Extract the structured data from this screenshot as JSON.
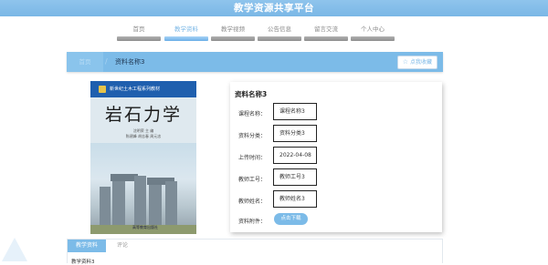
{
  "app": {
    "title": "教学资源共享平台"
  },
  "nav": {
    "items": [
      {
        "label": "首页",
        "active": false
      },
      {
        "label": "教学资料",
        "active": true
      },
      {
        "label": "教学视频",
        "active": false
      },
      {
        "label": "公告信息",
        "active": false
      },
      {
        "label": "留言交流",
        "active": false
      },
      {
        "label": "个人中心",
        "active": false
      }
    ]
  },
  "breadcrumb": {
    "home": "首页",
    "separator": "/",
    "current": "资料名称3",
    "favorite_label": "点我收藏"
  },
  "book": {
    "series": "新世纪土木工程系列教材",
    "title": "岩石力学",
    "author_line1": "沈明荣  主 编",
    "author_line2": "陈建峰  胡志春  周元忠",
    "publisher": "高等教育出版社"
  },
  "detail": {
    "title": "资料名称3",
    "rows": [
      {
        "label": "课程名称：",
        "value": "课程名称3"
      },
      {
        "label": "资料分类：",
        "value": "资料分类3"
      },
      {
        "label": "上传时间：",
        "value": "2022-04-08"
      },
      {
        "label": "教师工号：",
        "value": "教师工号3"
      },
      {
        "label": "教师姓名：",
        "value": "教师姓名3"
      },
      {
        "label": "资料附件：",
        "value": ""
      }
    ],
    "download_label": "点击下载"
  },
  "tabs": {
    "items": [
      {
        "label": "教学资料",
        "active": true
      },
      {
        "label": "评论",
        "active": false
      }
    ],
    "body_text": "教学资料3"
  },
  "colors": {
    "accent": "#7cbbe8",
    "header": "#8fc4ec",
    "nav_inactive": "#9a9a9a"
  }
}
